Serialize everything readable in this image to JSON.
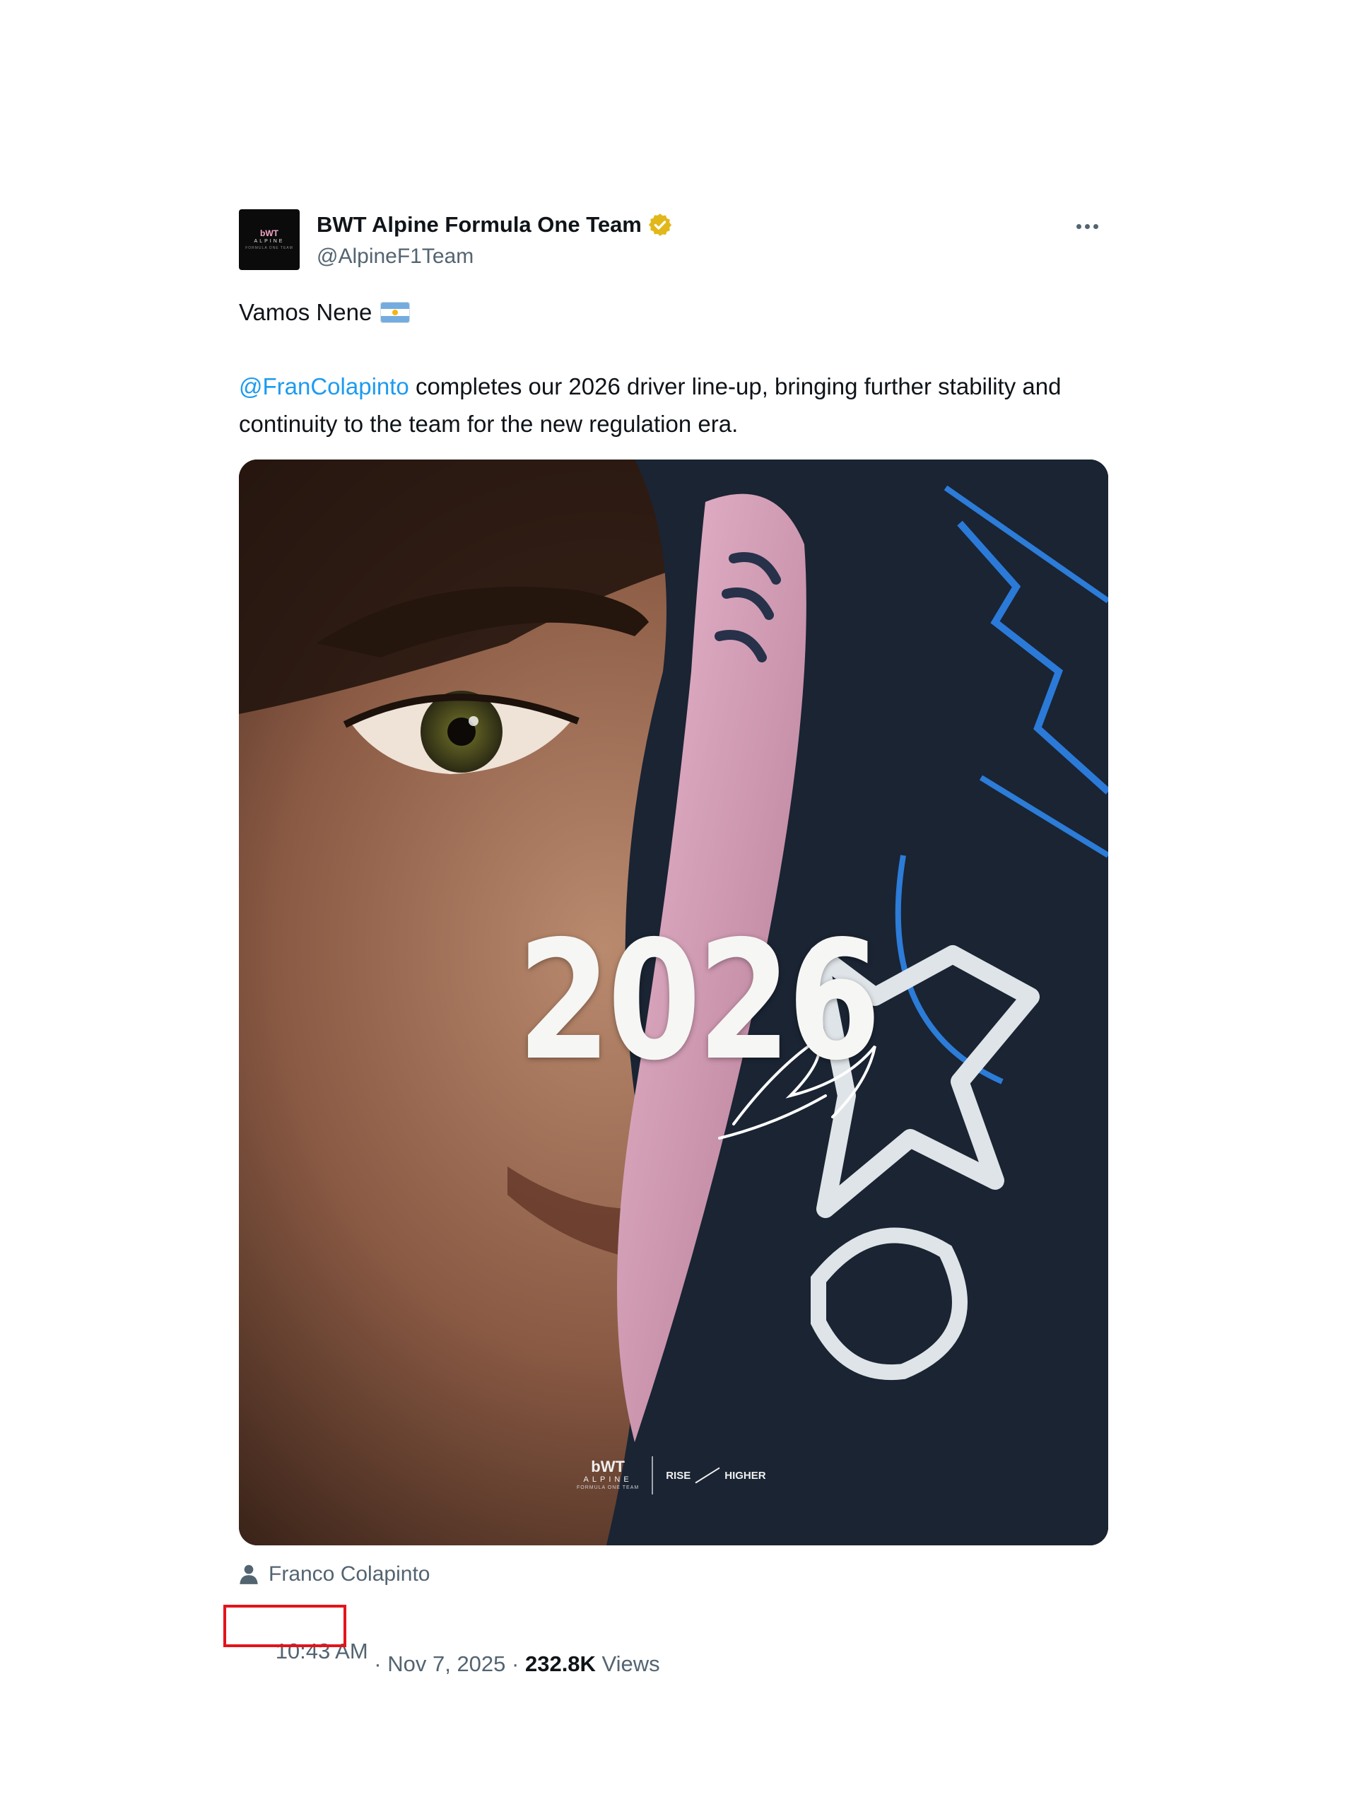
{
  "tweet": {
    "author": {
      "display_name": "BWT Alpine Formula One Team",
      "handle": "@AlpineF1Team",
      "avatar": {
        "line1": "bWT",
        "line2": "ALPINE",
        "line3": "FORMULA ONE TEAM"
      },
      "verified_badge_color": "#e2b719"
    },
    "more_icon": "more-horizontal-icon",
    "text": {
      "line1": "Vamos Nene",
      "flag": "argentina-flag-icon",
      "mention": "@FranColapinto",
      "body": " completes our 2026 driver line-up, bringing further stability and continuity to the team for the new regulation era."
    },
    "media": {
      "headline": "2026",
      "logo_brand": "bWT",
      "logo_name": "ALPINE",
      "logo_sub": "FORMULA ONE TEAM",
      "tagline_left": "RISE",
      "tagline_right": "HIGHER"
    },
    "tagged_person": {
      "icon": "person-icon",
      "name": "Franco Colapinto"
    },
    "meta": {
      "time": "10:43 AM",
      "separator1": " · ",
      "date": "Nov 7, 2025",
      "separator2": " · ",
      "views_count": "232.8K",
      "views_label": " Views"
    },
    "colors": {
      "link": "#1d9bf0",
      "secondary_text": "#536471",
      "highlight_box": "#e3141b"
    }
  }
}
